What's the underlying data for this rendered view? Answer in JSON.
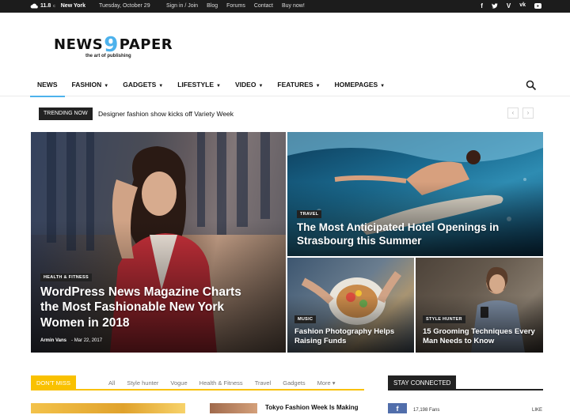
{
  "topbar": {
    "temp": "11.8",
    "temp_unit": "c",
    "city": "New York",
    "date": "Tuesday, October 29",
    "links": [
      "Sign in / Join",
      "Blog",
      "Forums",
      "Contact",
      "Buy now!"
    ],
    "social_icons": [
      "facebook-icon",
      "twitter-icon",
      "vimeo-icon",
      "vk-icon",
      "youtube-icon"
    ]
  },
  "logo": {
    "left": "NEWS",
    "nine": "9",
    "right": "PAPER",
    "tagline": "the art of publishing"
  },
  "nav": {
    "items": [
      {
        "label": "NEWS",
        "active": true,
        "dropdown": false
      },
      {
        "label": "FASHION",
        "dropdown": true
      },
      {
        "label": "GADGETS",
        "dropdown": true
      },
      {
        "label": "LIFESTYLE",
        "dropdown": true
      },
      {
        "label": "VIDEO",
        "dropdown": true
      },
      {
        "label": "FEATURES",
        "dropdown": true
      },
      {
        "label": "HOMEPAGES",
        "dropdown": true
      }
    ],
    "caret": "▼"
  },
  "trending": {
    "label": "TRENDING NOW",
    "text": "Designer fashion show kicks off Variety Week",
    "prev": "‹",
    "next": "›"
  },
  "mosaic": {
    "main": {
      "category": "HEALTH & FITNESS",
      "title": "WordPress News Magazine Charts the Most Fashionable New York Women in 2018",
      "author": "Armin Vans",
      "date": "Mar 22, 2017"
    },
    "top_right": {
      "category": "TRAVEL",
      "title": "The Most Anticipated Hotel Openings in Strasbourg this Summer"
    },
    "bottom_left": {
      "category": "MUSIC",
      "title": "Fashion Photography Helps Raising Funds"
    },
    "bottom_right": {
      "category": "STYLE HUNTER",
      "title": "15 Grooming Techniques Every Man Needs to Know"
    }
  },
  "dont_miss": {
    "label": "DON'T MISS",
    "tabs": [
      "All",
      "Style hunter",
      "Vogue",
      "Health & Fitness",
      "Travel",
      "Gadgets",
      "More"
    ],
    "more_caret": "▾",
    "article_title": "Tokyo Fashion Week Is Making"
  },
  "stay_connected": {
    "label": "STAY CONNECTED",
    "fb_letter": "f",
    "fans": "17,198 Fans",
    "like": "LIKE"
  },
  "colors": {
    "accent": "#4db2ec",
    "dont_miss": "#f9c100",
    "dark": "#222222",
    "facebook": "#516eab"
  }
}
